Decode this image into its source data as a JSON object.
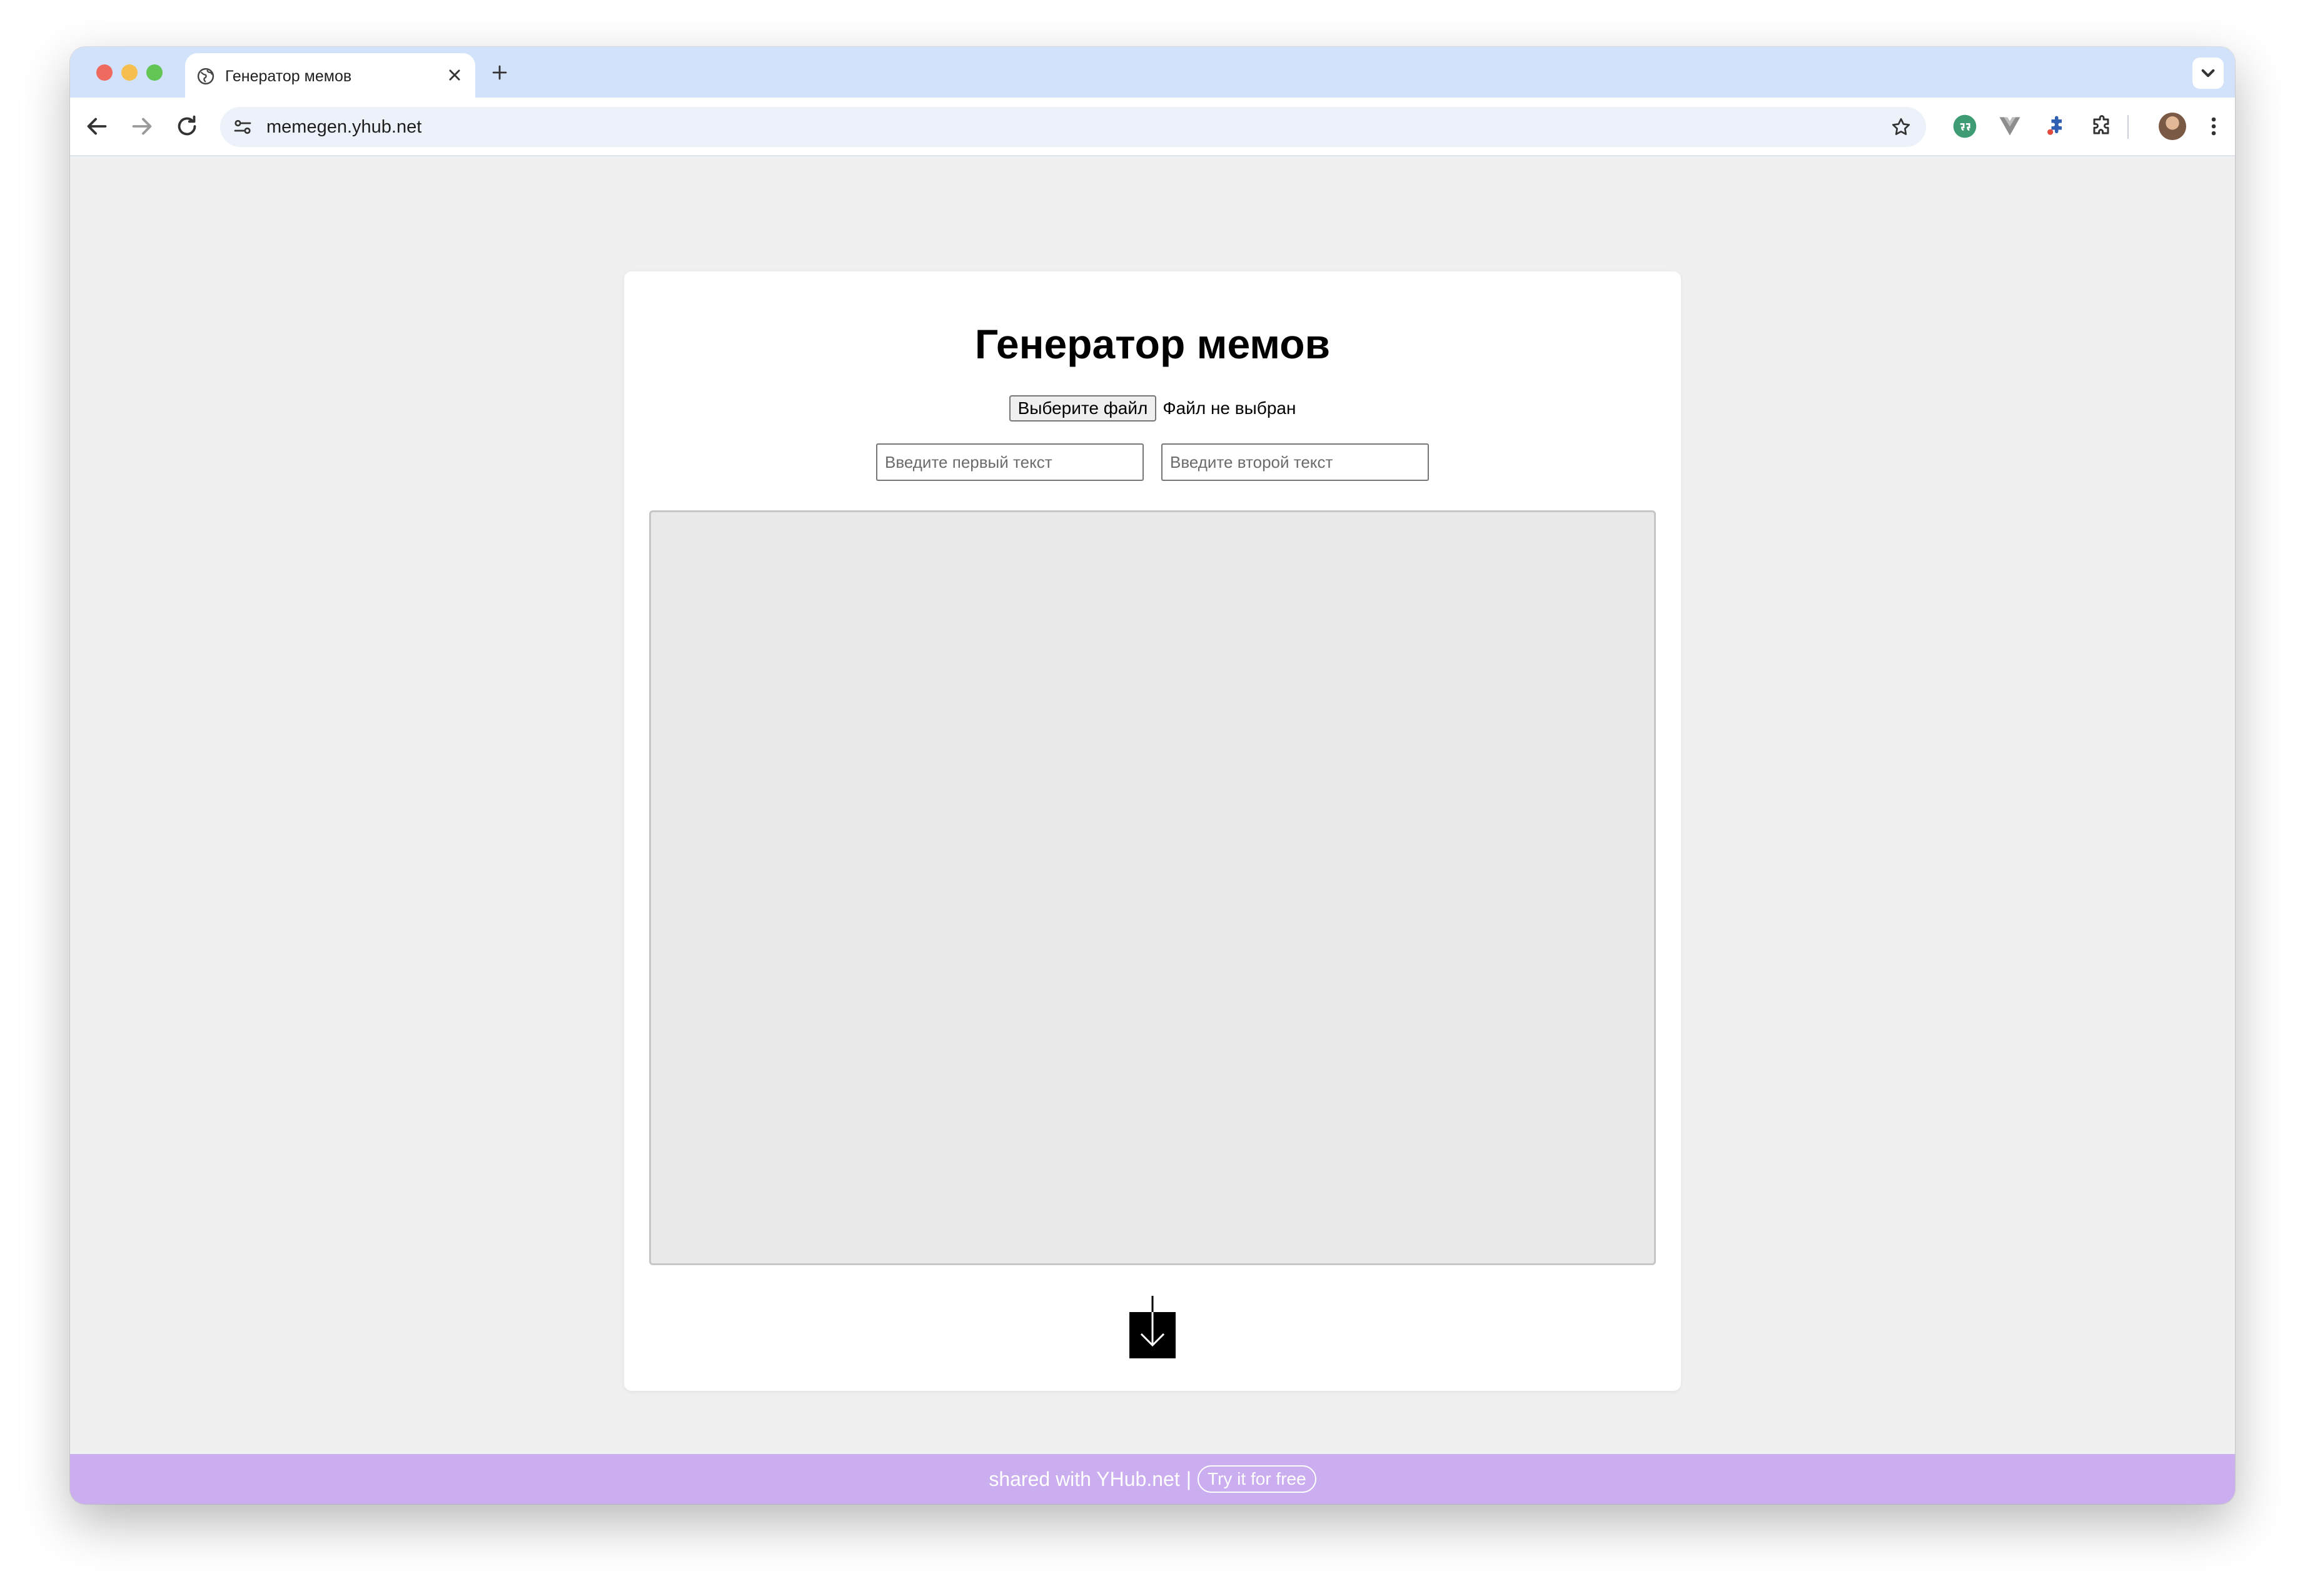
{
  "browser": {
    "tab": {
      "title": "Генератор мемов"
    },
    "url": "memegen.yhub.net"
  },
  "page": {
    "title": "Генератор мемов",
    "file_button_label": "Выберите файл",
    "file_status": "Файл не выбран",
    "first_text_placeholder": "Введите первый текст",
    "second_text_placeholder": "Введите второй текст",
    "download_icon": "download-arrow-icon"
  },
  "footer": {
    "shared_text": "shared with YHub.net",
    "separator": "|",
    "cta_label": "Try it for free"
  },
  "colors": {
    "tab_bar": "#d3e2fb",
    "omnibox": "#edf2fa",
    "page_bg": "#f0f0f0",
    "canvas_bg": "#e9e9e9",
    "footer_bg": "#cbaeef"
  }
}
